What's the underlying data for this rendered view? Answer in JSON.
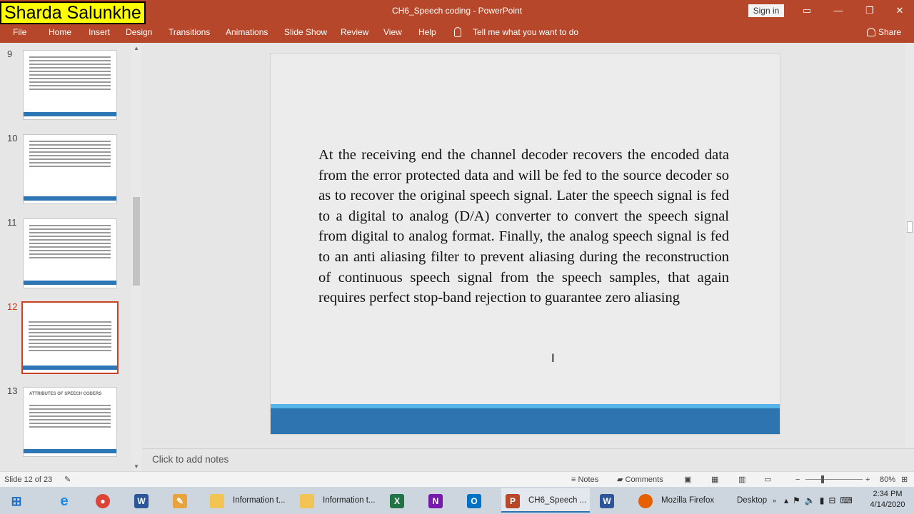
{
  "watermark": "Sharda Salunkhe",
  "window": {
    "title": "CH6_Speech coding  -  PowerPoint",
    "sign_in": "Sign in",
    "minimize": "—",
    "restore": "❐",
    "close": "✕",
    "ribbon_display": "▭"
  },
  "ribbon": {
    "tabs": [
      "File",
      "Home",
      "Insert",
      "Design",
      "Transitions",
      "Animations",
      "Slide Show",
      "Review",
      "View",
      "Help"
    ],
    "tell_me": "Tell me what you want to do",
    "share": "Share"
  },
  "thumbnails": [
    {
      "num": "9"
    },
    {
      "num": "10"
    },
    {
      "num": "11"
    },
    {
      "num": "12"
    },
    {
      "num": "13",
      "title": "ATTRIBUTES OF SPEECH CODERS"
    }
  ],
  "slide": {
    "body": "At the receiving end the channel decoder recovers the encoded data from the error protected data and will be fed to the source decoder so as to recover the original speech signal. Later the speech signal is fed to a digital to analog (D/A) converter to convert the speech signal from digital to analog format. Finally, the analog speech signal is fed to an anti aliasing filter to prevent aliasing during the reconstruction of continuous speech signal from the speech samples, that again requires perfect stop-band rejection to guarantee zero aliasing",
    "band_color": "#2d74b0",
    "band_light_color": "#56b4e9"
  },
  "notes": {
    "placeholder": "Click to add notes"
  },
  "status": {
    "slide_info": "Slide 12 of 23",
    "notes": "Notes",
    "comments": "Comments",
    "zoom_minus": "−",
    "zoom_plus": "+",
    "zoom": "80%"
  },
  "taskbar": {
    "items": [
      {
        "label": "Information t...",
        "icon": "folder"
      },
      {
        "label": "Information t...",
        "icon": "folder"
      },
      {
        "label": "CH6_Speech ...",
        "icon": "powerpoint"
      },
      {
        "label": "Mozilla Firefox",
        "icon": "firefox"
      }
    ],
    "desktop": "Desktop",
    "time": "2:34 PM",
    "date": "4/14/2020"
  },
  "colors": {
    "accent": "#b7472a",
    "selected_border": "#c9411f"
  }
}
